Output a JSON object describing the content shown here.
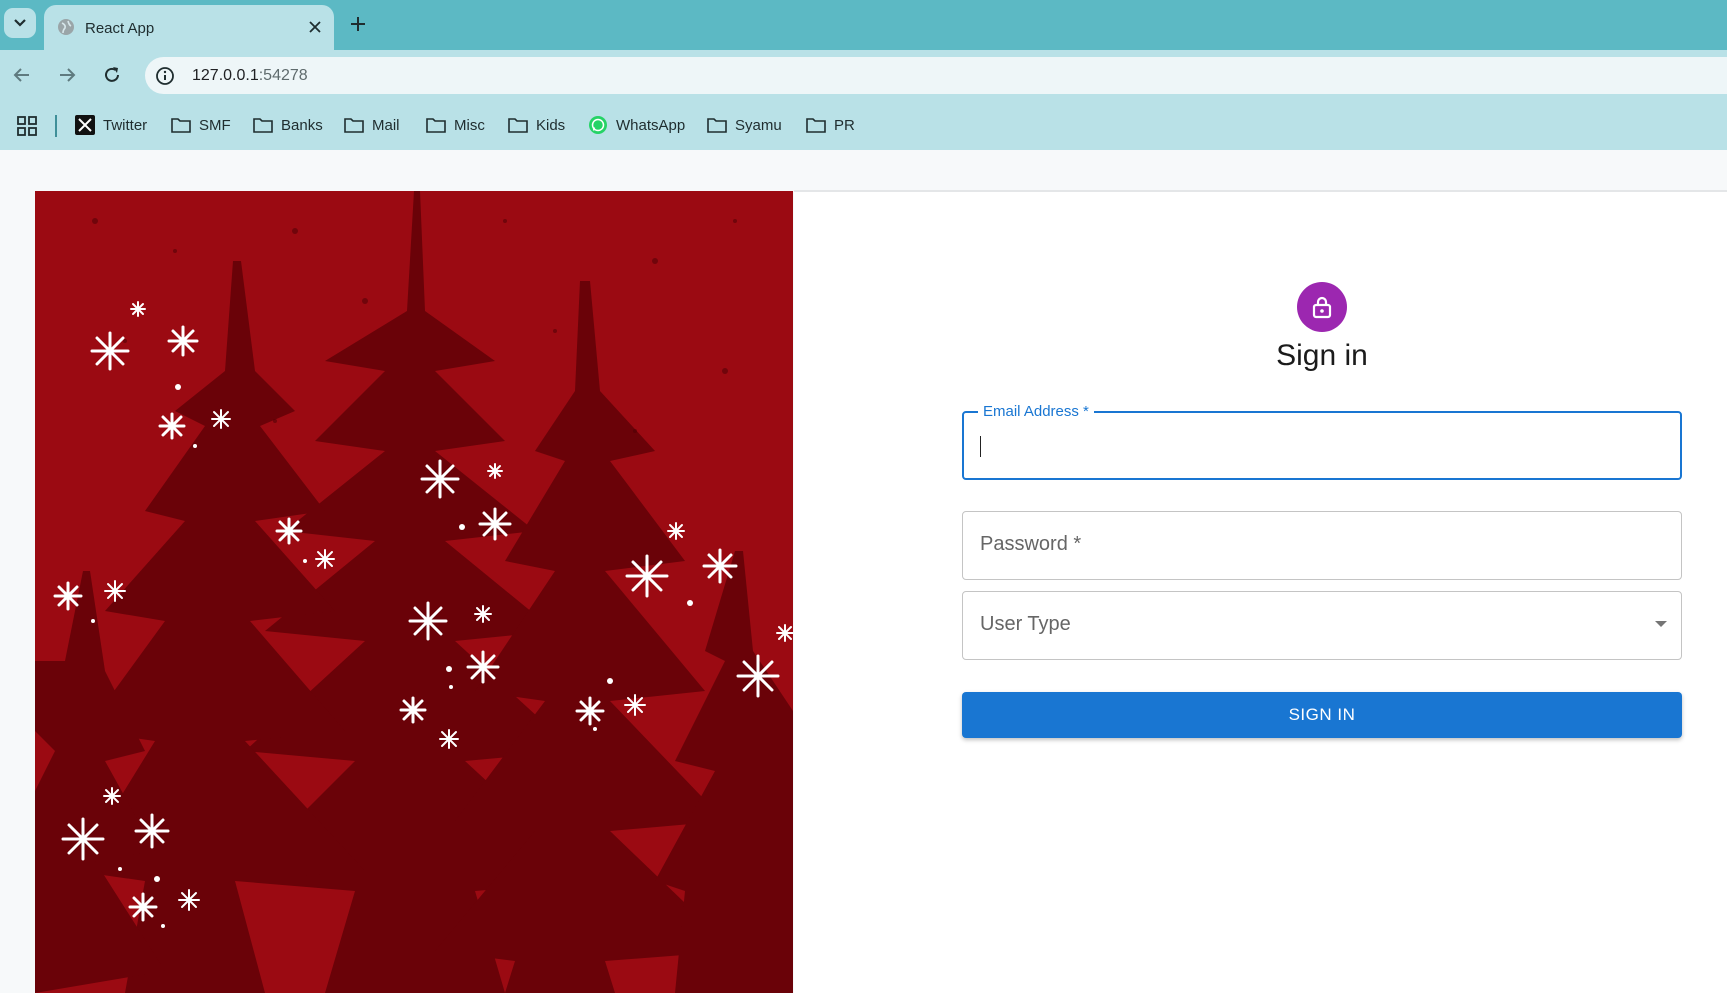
{
  "browser": {
    "tab_title": "React App",
    "url_host": "127.0.0.1",
    "url_port": ":54278",
    "bookmarks": [
      {
        "label": "Twitter",
        "icon": "x-logo-icon"
      },
      {
        "label": "SMF",
        "icon": "folder-icon"
      },
      {
        "label": "Banks",
        "icon": "folder-icon"
      },
      {
        "label": "Mail",
        "icon": "folder-icon"
      },
      {
        "label": "Misc",
        "icon": "folder-icon"
      },
      {
        "label": "Kids",
        "icon": "folder-icon"
      },
      {
        "label": "WhatsApp",
        "icon": "whatsapp-icon"
      },
      {
        "label": "Syamu",
        "icon": "folder-icon"
      },
      {
        "label": "PR",
        "icon": "folder-icon"
      }
    ]
  },
  "login": {
    "title": "Sign in",
    "email_label": "Email Address *",
    "email_value": "",
    "password_placeholder": "Password *",
    "user_type_placeholder": "User Type",
    "submit_label": "SIGN IN"
  },
  "colors": {
    "tabstrip": "#5cb9c4",
    "toolbar": "#b9e1e7",
    "avatar": "#9c27b0",
    "primary": "#1976d2",
    "hero_red": "#9b0a12",
    "hero_tree": "#6a0208"
  }
}
